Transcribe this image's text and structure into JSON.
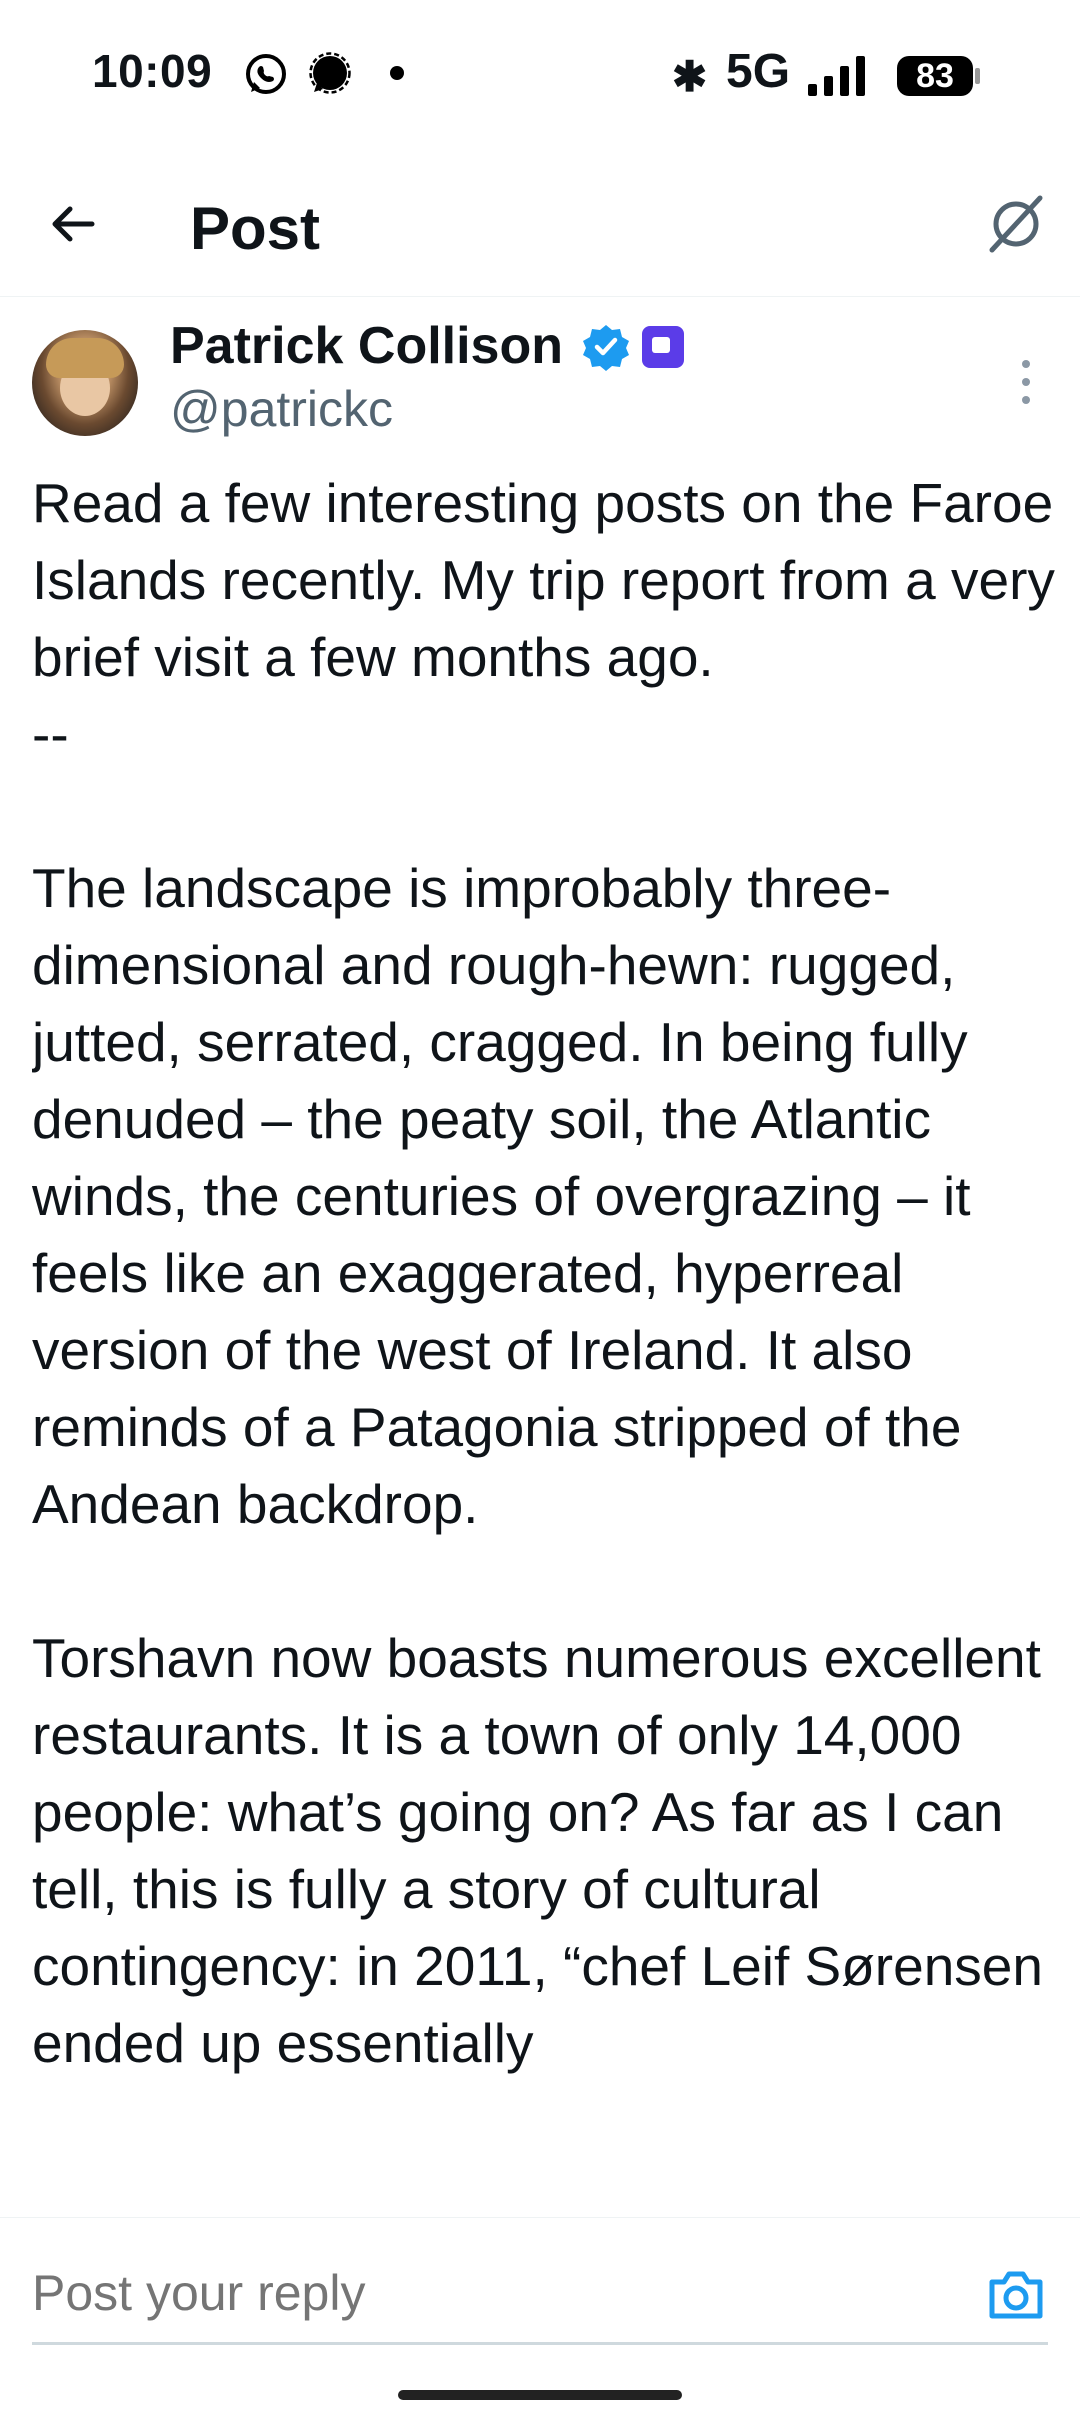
{
  "status_bar": {
    "time": "10:09",
    "network": "5G",
    "battery": "83",
    "icons": [
      "whatsapp-icon",
      "signal-app-icon",
      "notification-dot-icon",
      "bluetooth-icon",
      "cell-signal-icon",
      "battery-icon"
    ]
  },
  "header": {
    "title": "Post",
    "back_icon": "arrow-left-icon",
    "grok_icon": "grok-icon"
  },
  "author": {
    "name": "Patrick Collison",
    "handle": "@patrickc",
    "verified": true,
    "colors": {
      "verified": "#1d9bf0",
      "affiliate": "#5b3ce8"
    }
  },
  "post": {
    "text": "Read a few interesting posts on the Faroe Islands recently. My trip report from a very brief visit a few months ago.\n--\n\nThe landscape is improbably three-dimensional and rough-hewn: rugged, jutted, serrated, cragged. In being fully denuded – the peaty soil, the Atlantic winds, the centuries of overgrazing – it feels like an exaggerated, hyperreal version of the west of Ireland. It also reminds of a Patagonia stripped of the Andean backdrop.\n\nTorshavn now boasts numerous excellent restaurants. It is a town of only 14,000 people: what’s going on? As far as I can tell, this is fully a story of cultural contingency: in 2011, “chef Leif Sørensen ended up essentially"
  },
  "reply": {
    "placeholder": "Post your reply",
    "accent": "#1d9bf0"
  }
}
